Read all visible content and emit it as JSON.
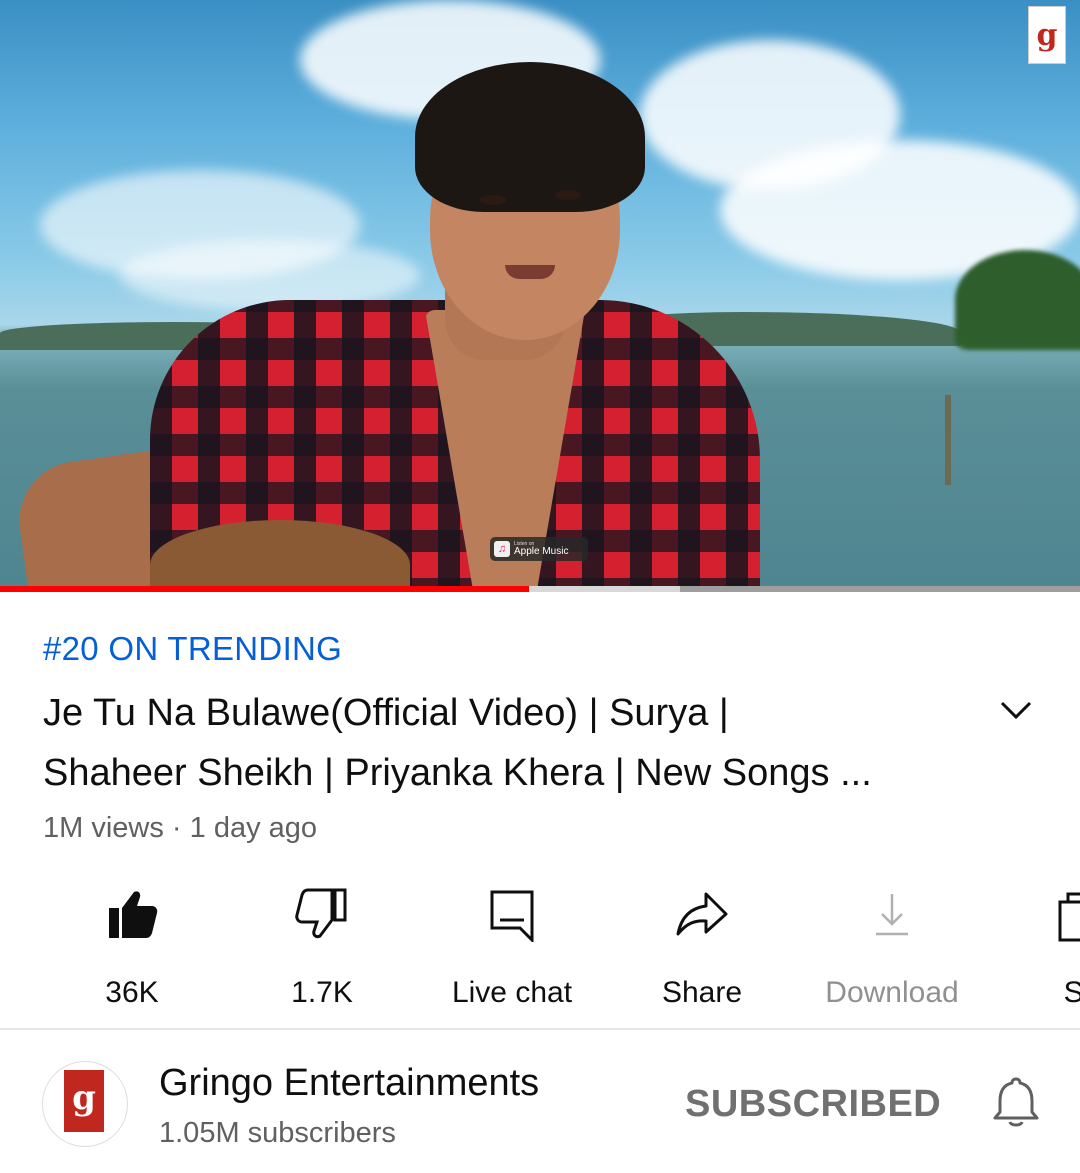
{
  "video": {
    "watermark_letter": "g",
    "apple_badge_small": "Listen on",
    "apple_badge_label": "Apple Music",
    "progress_played": 0.49,
    "progress_buffered": 0.63
  },
  "info": {
    "trending": "#20 ON TRENDING",
    "title_line1": "Je Tu Na Bulawe(Official Video) | Surya |",
    "title_line2": "Shaheer Sheikh | Priyanka Khera | New Songs ...",
    "meta": "1M views · 1 day ago",
    "expand_icon": "chevron-down-icon"
  },
  "actions": [
    {
      "label": "36K",
      "icon": "thumbs-up-filled-icon"
    },
    {
      "label": "1.7K",
      "icon": "thumbs-down-icon"
    },
    {
      "label": "Live chat",
      "icon": "chat-icon"
    },
    {
      "label": "Share",
      "icon": "share-icon"
    },
    {
      "label": "Download",
      "icon": "download-icon",
      "disabled": true
    },
    {
      "label": "Sa",
      "icon": "save-playlist-icon"
    }
  ],
  "channel": {
    "name": "Gringo Entertainments",
    "subscribers": "1.05M subscribers",
    "subscribe_state": "SUBSCRIBED",
    "avatar_letter": "g",
    "bell_icon": "notification-bell-icon"
  },
  "colors": {
    "trending": "#065fd4",
    "progress": "#ff0000",
    "brand_red": "#c0271f"
  }
}
